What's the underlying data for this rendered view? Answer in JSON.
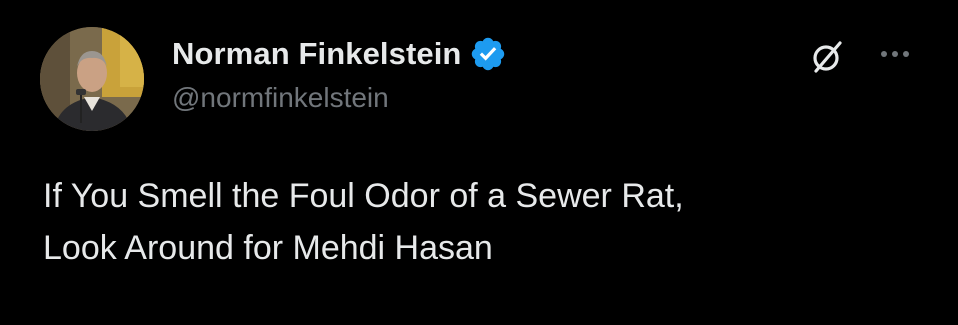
{
  "theme": {
    "background": "#000000",
    "text_primary": "#e7e9ea",
    "text_secondary": "#71767b",
    "verified_blue": "#1d9bf0"
  },
  "author": {
    "display_name": "Norman Finkelstein",
    "handle": "@normfinkelstein",
    "verified": true,
    "avatar_icon": "profile-photo"
  },
  "actions": {
    "grok_icon": "grok-icon",
    "more_icon": "more-options-icon"
  },
  "tweet": {
    "lines": [
      "If You Smell the Foul Odor of a Sewer Rat,",
      "Look Around for Mehdi Hasan"
    ]
  }
}
